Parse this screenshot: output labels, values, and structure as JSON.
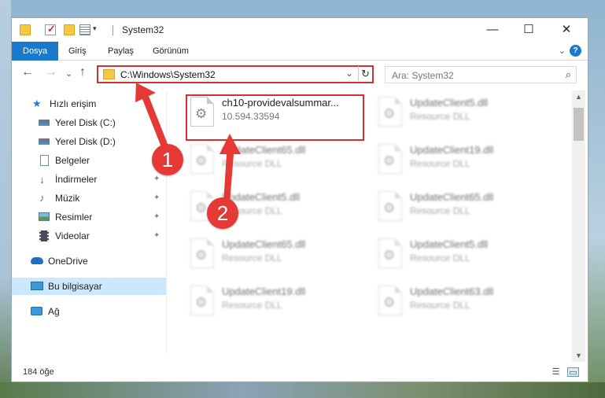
{
  "titlebar": {
    "title": "System32",
    "minimize": "—",
    "maximize": "☐",
    "close": "✕",
    "qa_dropdown": "▾"
  },
  "ribbon": {
    "tabs": [
      "Dosya",
      "Giriş",
      "Paylaş",
      "Görünüm"
    ],
    "expand": "⌄",
    "help": "?"
  },
  "nav": {
    "back": "←",
    "forward": "→",
    "recent": "⌄",
    "up": "↑",
    "address": "C:\\Windows\\System32",
    "address_dropdown": "⌄",
    "refresh": "↻",
    "search_placeholder": "Ara: System32",
    "search_icon": "⌕"
  },
  "sidebar": {
    "items": [
      {
        "label": "Hızlı erişim",
        "icon": "star-icon"
      },
      {
        "label": "Yerel Disk (C:)",
        "icon": "drive-icon",
        "pinned": true
      },
      {
        "label": "Yerel Disk (D:)",
        "icon": "drive-icon",
        "pinned": true
      },
      {
        "label": "Belgeler",
        "icon": "document-icon",
        "pinned": true
      },
      {
        "label": "İndirmeler",
        "icon": "download-icon",
        "pinned": true
      },
      {
        "label": "Müzik",
        "icon": "music-icon",
        "pinned": true
      },
      {
        "label": "Resimler",
        "icon": "pictures-icon",
        "pinned": true
      },
      {
        "label": "Videolar",
        "icon": "video-icon",
        "pinned": true
      },
      {
        "label": "OneDrive",
        "icon": "cloud-icon"
      },
      {
        "label": "Bu bilgisayar",
        "icon": "computer-icon",
        "selected": true
      },
      {
        "label": "Ağ",
        "icon": "network-icon"
      }
    ],
    "pin_glyph": "📌"
  },
  "files": [
    {
      "name": "ch10-providevalsummar...",
      "desc": "10.594.33594",
      "blurred": false,
      "highlighted": true
    },
    {
      "name": "UpdateClient5.dll",
      "desc": "Resource DLL",
      "blurred": true
    },
    {
      "name": "UpdateClient65.dll",
      "desc": "Resource DLL",
      "blurred": true
    },
    {
      "name": "UpdateClient19.dll",
      "desc": "Resource DLL",
      "blurred": true
    },
    {
      "name": "UpdateClient5.dll",
      "desc": "Resource DLL",
      "blurred": true
    },
    {
      "name": "UpdateClient65.dll",
      "desc": "Resource DLL",
      "blurred": true
    },
    {
      "name": "UpdateClient65.dll",
      "desc": "Resource DLL",
      "blurred": true
    },
    {
      "name": "UpdateClient5.dll",
      "desc": "Resource DLL",
      "blurred": true
    },
    {
      "name": "UpdateClient19.dll",
      "desc": "Resource DLL",
      "blurred": true
    },
    {
      "name": "UpdateClient63.dll",
      "desc": "Resource DLL",
      "blurred": true
    }
  ],
  "gear_glyph": "⚙",
  "scrollbar": {
    "up": "▲",
    "down": "▼"
  },
  "status": {
    "item_count": "184 öğe",
    "details_view": "☰",
    "tiles_view": "▭"
  },
  "annotations": {
    "callout_1": "1",
    "callout_2": "2"
  },
  "colors": {
    "accent": "#1979ca",
    "annotation": "#e53935",
    "selected": "#cce8ff",
    "folder": "#f5c842"
  }
}
